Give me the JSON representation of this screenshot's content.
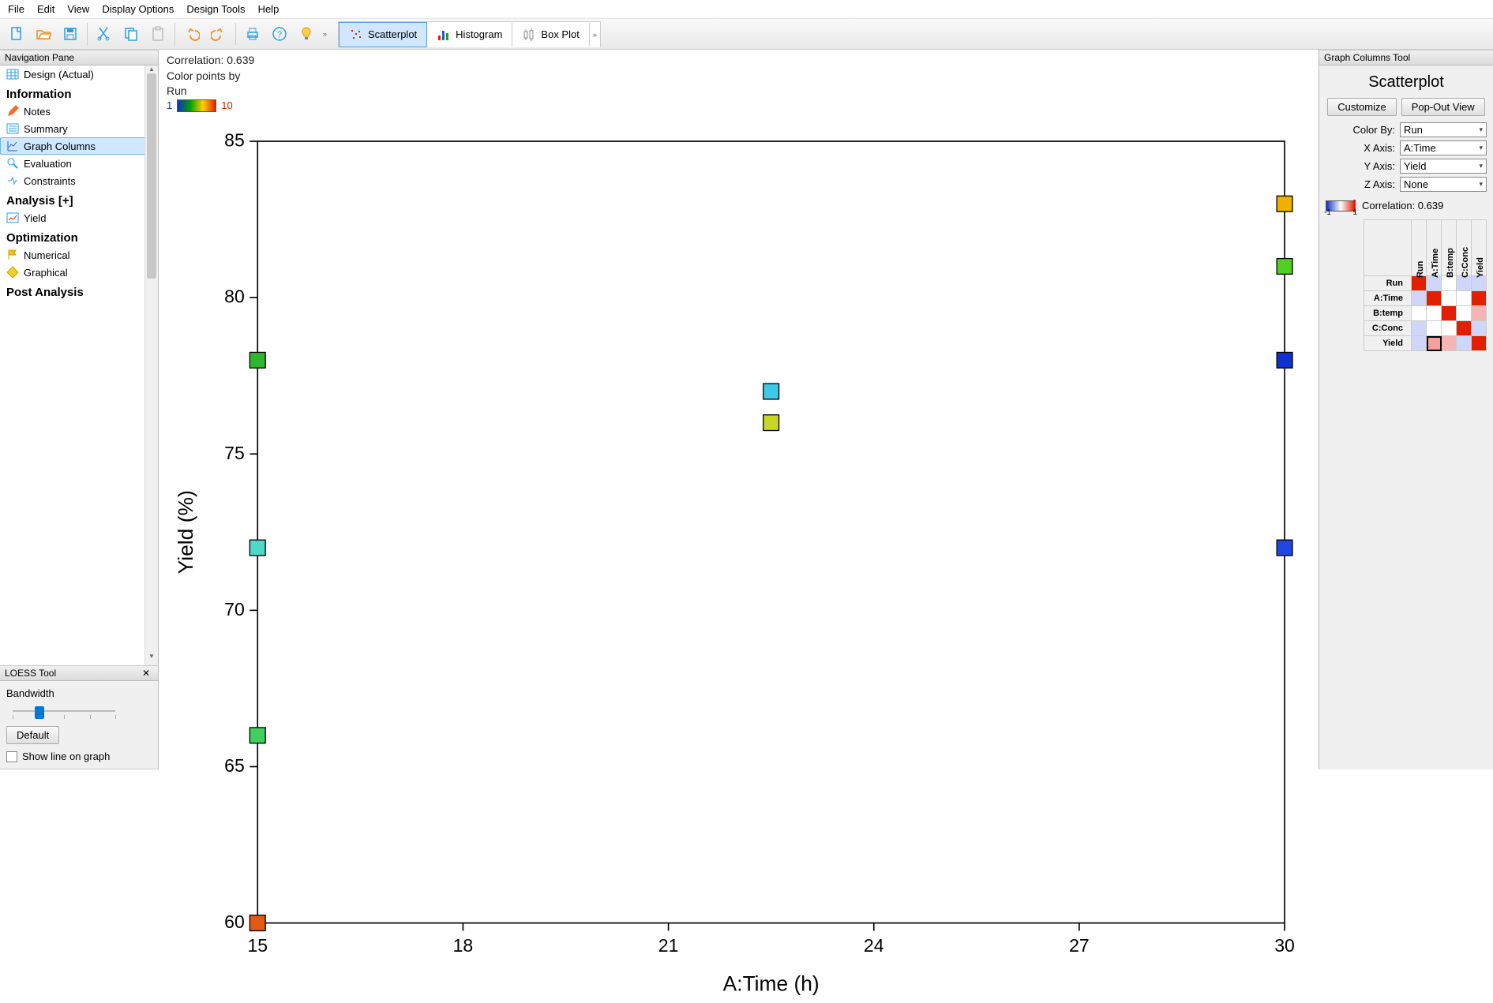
{
  "menu": {
    "file": "File",
    "edit": "Edit",
    "view": "View",
    "display": "Display Options",
    "design": "Design Tools",
    "help": "Help"
  },
  "chart_tabs": {
    "scatter": "Scatterplot",
    "histogram": "Histogram",
    "box": "Box Plot"
  },
  "nav": {
    "header": "Navigation Pane",
    "design": "Design (Actual)",
    "section_info": "Information",
    "notes": "Notes",
    "summary": "Summary",
    "graph_columns": "Graph Columns",
    "evaluation": "Evaluation",
    "constraints": "Constraints",
    "section_analysis": "Analysis [+]",
    "yield": "Yield",
    "section_opt": "Optimization",
    "numerical": "Numerical",
    "graphical": "Graphical",
    "section_post": "Post Analysis"
  },
  "loess": {
    "header": "LOESS Tool",
    "bandwidth": "Bandwidth",
    "default_btn": "Default",
    "show_line": "Show line on graph"
  },
  "center": {
    "correlation": "Correlation: 0.639",
    "color_by": "Color points by",
    "color_var": "Run",
    "scale_min": "1",
    "scale_max": "10"
  },
  "right": {
    "header": "Graph Columns Tool",
    "title": "Scatterplot",
    "customize": "Customize",
    "popout": "Pop-Out View",
    "color_by_lbl": "Color By:",
    "color_by_val": "Run",
    "xaxis_lbl": "X Axis:",
    "xaxis_val": "A:Time",
    "yaxis_lbl": "Y Axis:",
    "yaxis_val": "Yield",
    "zaxis_lbl": "Z Axis:",
    "zaxis_val": "None",
    "corr_neg": "-1",
    "corr_pos": "1",
    "corr_text": "Correlation: 0.639",
    "matrix_vars": [
      "Run",
      "A:Time",
      "B:temp",
      "C:Conc",
      "Yield"
    ]
  },
  "chart_data": {
    "type": "scatter",
    "title": "",
    "xlabel": "A:Time (h)",
    "ylabel": "Yield (%)",
    "xlim": [
      15,
      30
    ],
    "ylim": [
      60,
      85
    ],
    "xticks": [
      15,
      18,
      21,
      24,
      27,
      30
    ],
    "yticks": [
      60,
      65,
      70,
      75,
      80,
      85
    ],
    "color_by": "Run",
    "points": [
      {
        "x": 15,
        "y": 78,
        "color": "#2fb82f"
      },
      {
        "x": 15,
        "y": 72,
        "color": "#4fd8c8"
      },
      {
        "x": 15,
        "y": 66,
        "color": "#40d060"
      },
      {
        "x": 15,
        "y": 60,
        "color": "#e05a10"
      },
      {
        "x": 22.5,
        "y": 77,
        "color": "#40c8e8"
      },
      {
        "x": 22.5,
        "y": 76,
        "color": "#c8d820"
      },
      {
        "x": 30,
        "y": 83,
        "color": "#f0b000"
      },
      {
        "x": 30,
        "y": 81,
        "color": "#50d020"
      },
      {
        "x": 30,
        "y": 78,
        "color": "#1030d0"
      },
      {
        "x": 30,
        "y": 72,
        "color": "#2048e0"
      }
    ],
    "correlation_matrix": {
      "vars": [
        "Run",
        "A:Time",
        "B:temp",
        "C:Conc",
        "Yield"
      ],
      "colors": [
        [
          "#e02000",
          "#cfd6f8",
          "#ffffff",
          "#cfd6f8",
          "#cfd6f8"
        ],
        [
          "#cfd6f8",
          "#e02000",
          "#ffffff",
          "#ffffff",
          "#e02000"
        ],
        [
          "#ffffff",
          "#ffffff",
          "#e02000",
          "#ffffff",
          "#f5b5b5"
        ],
        [
          "#cfd6f8",
          "#ffffff",
          "#ffffff",
          "#e02000",
          "#cfd6f8"
        ],
        [
          "#cfd6f8",
          "#f5a0a0",
          "#f5b5b5",
          "#cfd6f8",
          "#e02000"
        ]
      ],
      "highlight": [
        4,
        1
      ]
    }
  }
}
